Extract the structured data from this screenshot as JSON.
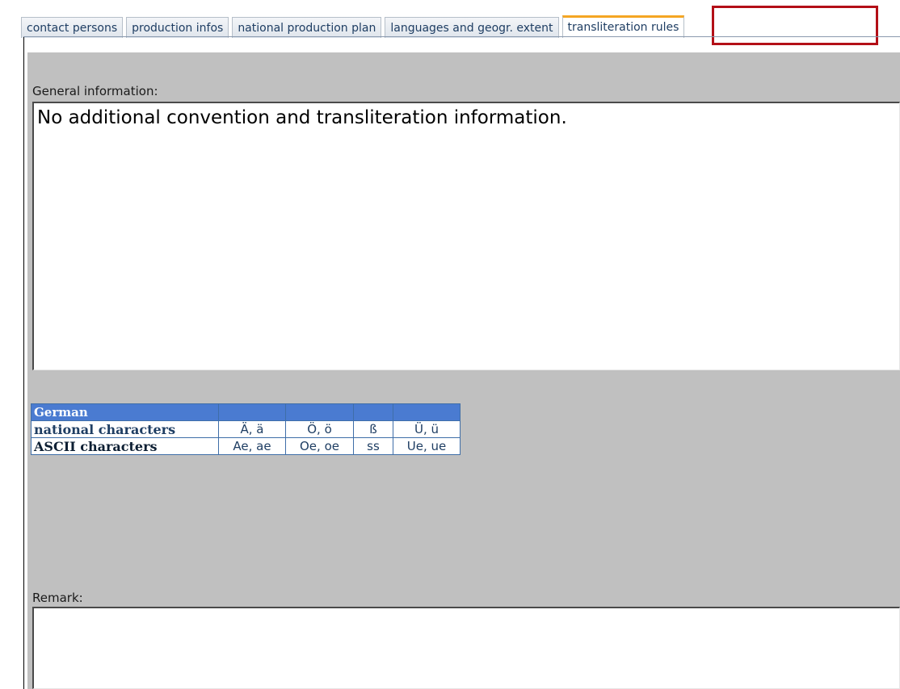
{
  "tabs": [
    {
      "label": "contact persons"
    },
    {
      "label": "production infos"
    },
    {
      "label": "national production plan"
    },
    {
      "label": "languages and geogr. extent"
    },
    {
      "label": "transliteration rules"
    }
  ],
  "active_tab": "transliteration rules",
  "general": {
    "label": "General information:",
    "value": "No additional convention and transliteration information."
  },
  "table": {
    "language": "German",
    "header_cells": [
      "",
      "",
      "",
      ""
    ],
    "rows": [
      {
        "label": "national characters",
        "cells": [
          "Ä, ä",
          "Ö, ö",
          "ß",
          "Ü, ü"
        ]
      },
      {
        "label": "ASCII characters",
        "cells": [
          "Ae, ae",
          "Oe, oe",
          "ss",
          "Ue, ue"
        ]
      }
    ]
  },
  "remark": {
    "label": "Remark:",
    "value": ""
  },
  "colors": {
    "table_header_bg": "#4a7bd1",
    "panel_bg": "#c0c0c0",
    "highlight_border": "#b30f17",
    "active_tab_accent": "#f5a623"
  }
}
